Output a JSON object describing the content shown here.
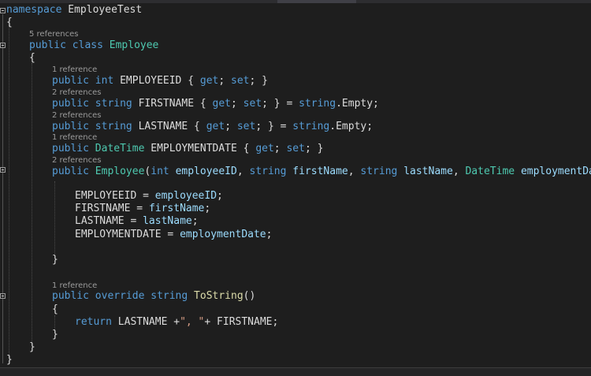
{
  "tokens": {
    "kw_namespace": "namespace",
    "ns_name": " EmployeeTest",
    "brace_open": "{",
    "brace_close": "}",
    "kw_public": "public",
    "kw_class": "class",
    "class_name": "Employee",
    "kw_int": "int",
    "kw_string": "string",
    "kw_get": "get",
    "kw_set": "set",
    "kw_override": "override",
    "kw_return": "return",
    "type_datetime": "DateTime",
    "prop_employeeid": "EMPLOYEEID",
    "prop_firstname": "FIRSTNAME",
    "prop_lastname": "LASTNAME",
    "prop_employmentdate": "EMPLOYMENTDATE",
    "accessor_body_open": " { ",
    "semi_space": "; ",
    "semi_close": "; }",
    "init_assign": " } = ",
    "empty_member": ".Empty;",
    "ctor_name": "Employee",
    "param_employeeid": "employeeID",
    "param_firstname": "firstName",
    "param_lastname": "lastName",
    "param_employmentdate": "employmentDate",
    "assign": " = ",
    "semicolon": ";",
    "method_tostring": "ToString",
    "paren_pair": "()",
    "str_comma": "\", \"",
    "plus_space": " +",
    "plus_tail": "+ FIRSTNAME;",
    "ret_lastname": " LASTNAME"
  },
  "codelens": {
    "class_refs": "5 references",
    "employeeid_refs": "1 reference",
    "firstname_refs": "2 references",
    "lastname_refs": "2 references",
    "employmentdate_refs": "1 reference",
    "ctor_refs": "2 references",
    "tostring_refs": "1 reference"
  },
  "colors": {
    "background": "#1e1e1e",
    "keyword": "#569cd6",
    "type": "#4ec9b0",
    "parameter": "#9cdcfe",
    "method": "#dcdcaa",
    "string": "#d69d85",
    "plain": "#dcdcdc",
    "codelens": "#9b9b9b"
  }
}
